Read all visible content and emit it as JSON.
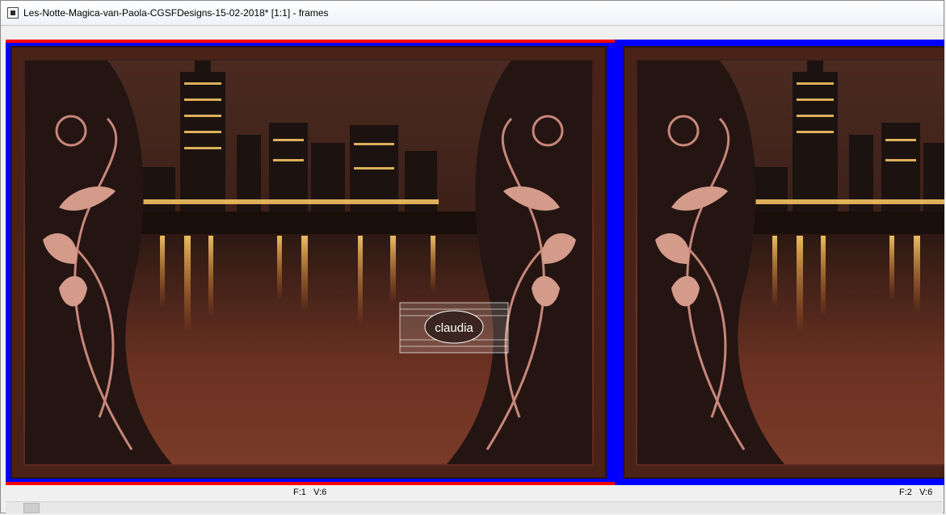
{
  "window": {
    "title": "Les-Notte-Magica-van-Paola-CGSFDesigns-15-02-2018* [1:1] - frames"
  },
  "frames": [
    {
      "status_f": "F:1",
      "status_v": "V:6",
      "watermark": "claudia"
    },
    {
      "status_f": "F:2",
      "status_v": "V:6"
    }
  ],
  "colors": {
    "selection_red": "#ff0000",
    "border_blue": "#0000ff",
    "art_dark": "#2a1510",
    "art_mid": "#6e3423",
    "swirl": "#c8877a"
  }
}
